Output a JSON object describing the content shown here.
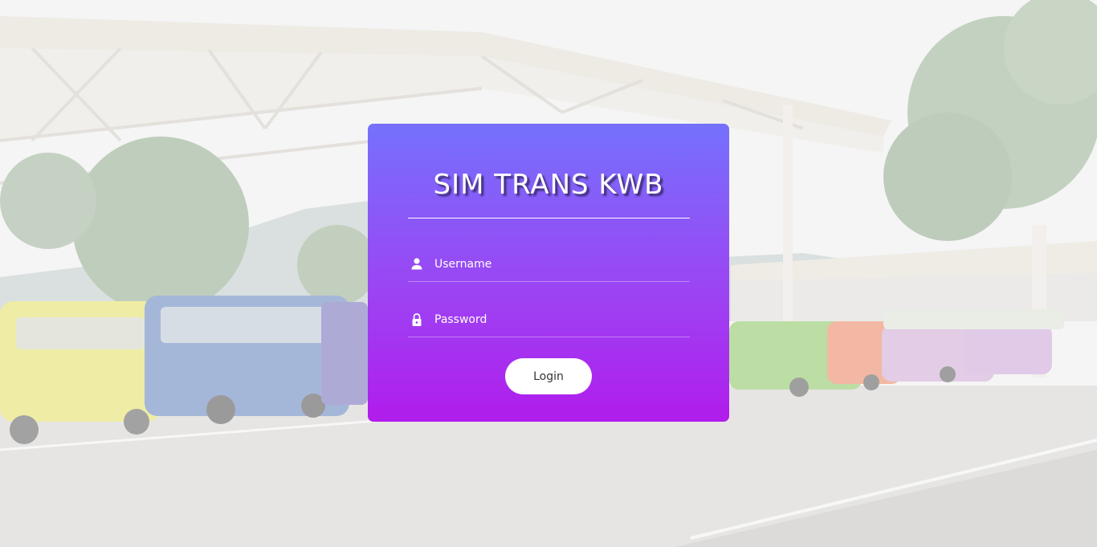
{
  "app": {
    "title": "SIM TRANS KWB"
  },
  "login_form": {
    "username": {
      "placeholder": "Username",
      "value": "",
      "icon": "user-icon"
    },
    "password": {
      "placeholder": "Password",
      "value": "",
      "icon": "lock-icon"
    },
    "login_label": "Login"
  },
  "colors": {
    "card_gradient_top": "#7571fd",
    "card_gradient_bottom": "#b11cec",
    "text": "#ffffff",
    "button_bg": "#ffffff",
    "button_text": "#333333"
  },
  "background": {
    "image": "bus-terminal-photo"
  }
}
